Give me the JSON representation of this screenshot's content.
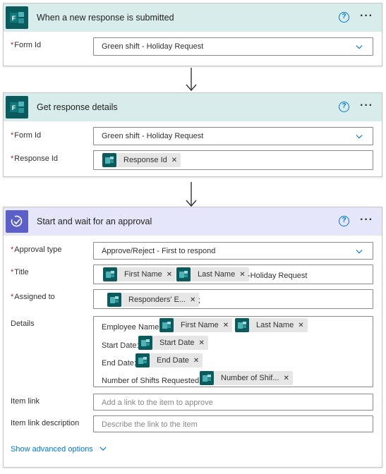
{
  "trigger": {
    "title": "When a new response is submitted",
    "form_id_label": "Form Id",
    "form_id_value": "Green shift - Holiday Request"
  },
  "get_details": {
    "title": "Get response details",
    "form_id_label": "Form Id",
    "form_id_value": "Green shift - Holiday Request",
    "response_id_label": "Response Id",
    "response_id_token": "Response Id"
  },
  "approval": {
    "title": "Start and wait for an approval",
    "approval_type_label": "Approval type",
    "approval_type_value": "Approve/Reject - First to respond",
    "title_label": "Title",
    "title_tokens": [
      "First Name",
      "Last Name"
    ],
    "title_suffix": "-Holiday Request",
    "assigned_label": "Assigned to",
    "assigned_token": "Responders' E...",
    "assigned_suffix": ";",
    "details_label": "Details",
    "details": {
      "employee_name_text": "Employee Name:",
      "first_name": "First Name",
      "last_name": "Last Name",
      "start_date_text": "Start Date:",
      "start_date": "Start Date",
      "end_date_text": "End Date:",
      "end_date": "End Date",
      "shifts_text": "Number of Shifts Requested:",
      "shifts": "Number of Shif..."
    },
    "item_link_label": "Item link",
    "item_link_placeholder": "Add a link to the item to approve",
    "item_link_desc_label": "Item link description",
    "item_link_desc_placeholder": "Describe the link to the item",
    "advanced_label": "Show advanced options"
  },
  "colors": {
    "forms_brand": "#0b5a5d",
    "approval_brand": "#5b5fc7",
    "link": "#0078d4",
    "required": "#a4262c"
  }
}
